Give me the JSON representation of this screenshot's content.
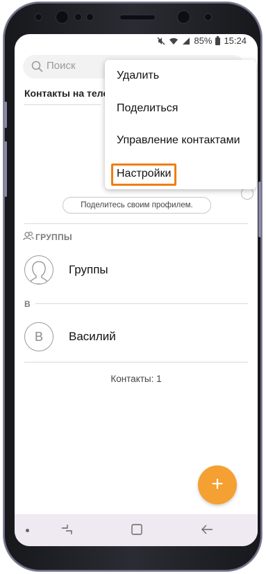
{
  "status_bar": {
    "battery": "85%",
    "time": "15:24"
  },
  "search": {
    "placeholder": "Поиск"
  },
  "header": {
    "section_title": "Контакты на теле"
  },
  "profile": {
    "share_button": "Поделитесь своим профилем."
  },
  "groups": {
    "header": "ГРУППЫ",
    "item_label": "Группы"
  },
  "alpha_index": {
    "letter": "В"
  },
  "contacts": [
    {
      "initial": "В",
      "name": "Василий"
    }
  ],
  "contacts_count": "Контакты: 1",
  "fab": {
    "symbol": "+"
  },
  "menu": {
    "items": [
      "Удалить",
      "Поделиться",
      "Управление контактами",
      "Настройки"
    ],
    "highlighted": "Настройки"
  },
  "colors": {
    "accent": "#f5a033",
    "highlight": "#ef7d14",
    "navbar": "#efe9f2"
  }
}
